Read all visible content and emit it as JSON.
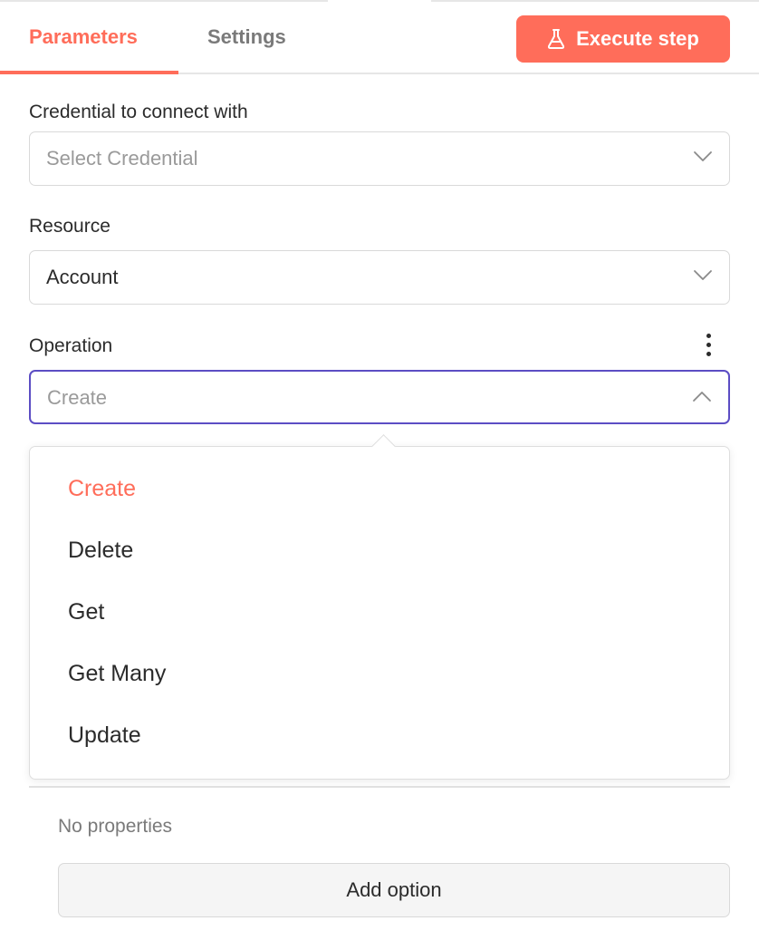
{
  "tabs": {
    "parameters": "Parameters",
    "settings": "Settings"
  },
  "execute_button": {
    "label": "Execute step",
    "icon": "flask-icon",
    "color": "#ff6d5a"
  },
  "credential": {
    "label": "Credential to connect with",
    "placeholder": "Select Credential"
  },
  "resource": {
    "label": "Resource",
    "value": "Account"
  },
  "operation": {
    "label": "Operation",
    "placeholder": "Create",
    "options": [
      "Create",
      "Delete",
      "Get",
      "Get Many",
      "Update"
    ],
    "selected": "Create"
  },
  "properties": {
    "empty_text": "No properties",
    "add_button": "Add option"
  },
  "colors": {
    "accent": "#ff6d5a",
    "focus": "#5c4dc4"
  }
}
